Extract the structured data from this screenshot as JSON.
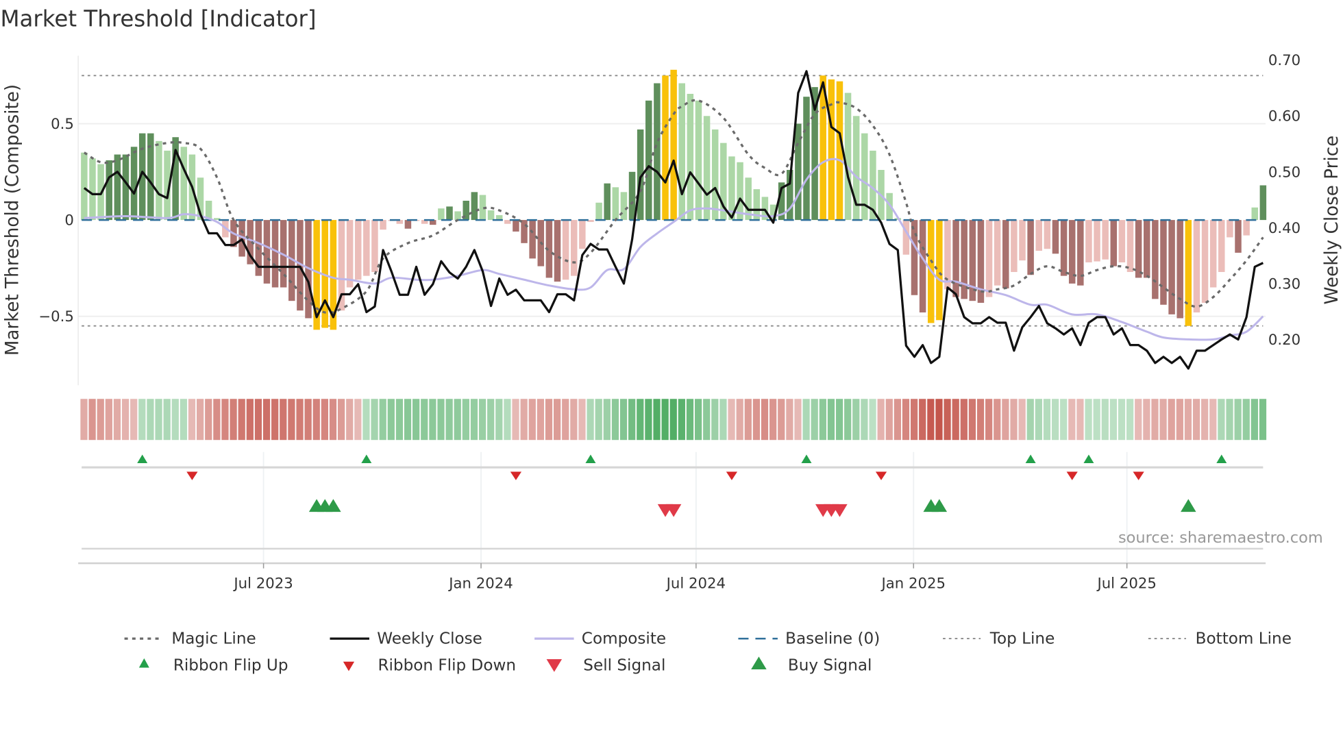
{
  "title": "Market Threshold [Indicator]",
  "source": "source: sharemaestro.com",
  "colors": {
    "dark_green": "#5f8f5c",
    "light_green": "#acd7a6",
    "dark_red": "#a8716e",
    "light_red": "#ebbdb9",
    "yellow": "#f9c10a",
    "close": "#111111",
    "composite": "#bdb6ea",
    "magic": "#6a6a6a",
    "baseline": "#2f6f9a",
    "guide": "#8a8a8a",
    "up": "#23a04a",
    "down": "#d62728",
    "sell": "#e03a48",
    "buy": "#2e9a48"
  },
  "chart_data": {
    "type": "bar+line",
    "title": "Market Threshold [Indicator]",
    "ylabel": "Market Threshold (Composite)",
    "y2label": "Weekly Close Price",
    "ylim": [
      -0.85,
      0.85
    ],
    "y2lim": [
      0.14,
      0.72
    ],
    "yticks": [
      {
        "v": 0.5,
        "label": "0.5"
      },
      {
        "v": 0,
        "label": "0"
      },
      {
        "v": -0.5,
        "label": "−0.5"
      }
    ],
    "y2ticks": [
      {
        "v": 0.7,
        "label": "0.70"
      },
      {
        "v": 0.6,
        "label": "0.60"
      },
      {
        "v": 0.5,
        "label": "0.50"
      },
      {
        "v": 0.4,
        "label": "0.40"
      },
      {
        "v": 0.3,
        "label": "0.30"
      },
      {
        "v": 0.2,
        "label": "0.20"
      }
    ],
    "xticks": [
      {
        "week": 21.6,
        "label": "Jul 2023"
      },
      {
        "week": 47.8,
        "label": "Jan 2024"
      },
      {
        "week": 73.7,
        "label": "Jul 2024"
      },
      {
        "week": 99.9,
        "label": "Jan 2025"
      },
      {
        "week": 125.6,
        "label": "Jul 2025"
      }
    ],
    "top_line": 0.75,
    "bottom_line": -0.55,
    "baseline": 0,
    "bars": {
      "values": [
        0.35,
        0.32,
        0.29,
        0.31,
        0.34,
        0.34,
        0.38,
        0.45,
        0.45,
        0.41,
        0.36,
        0.43,
        0.38,
        0.34,
        0.22,
        0.1,
        0.01,
        -0.09,
        -0.14,
        -0.19,
        -0.23,
        -0.29,
        -0.33,
        -0.35,
        -0.35,
        -0.42,
        -0.47,
        -0.51,
        -0.57,
        -0.56,
        -0.57,
        -0.47,
        -0.35,
        -0.31,
        -0.29,
        -0.27,
        -0.05,
        -0.005,
        -0.02,
        -0.045,
        -0.005,
        -0.02,
        -0.025,
        0.06,
        0.07,
        0.045,
        0.1,
        0.145,
        0.13,
        0.05,
        0.025,
        -0.02,
        -0.06,
        -0.12,
        -0.2,
        -0.24,
        -0.3,
        -0.32,
        -0.31,
        -0.29,
        -0.15,
        -0.01,
        0.09,
        0.19,
        0.17,
        0.145,
        0.25,
        0.47,
        0.62,
        0.71,
        0.75,
        0.78,
        0.71,
        0.655,
        0.62,
        0.54,
        0.47,
        0.4,
        0.33,
        0.3,
        0.22,
        0.16,
        0.12,
        0.08,
        0.195,
        0.26,
        0.5,
        0.64,
        0.69,
        0.75,
        0.73,
        0.72,
        0.66,
        0.54,
        0.45,
        0.36,
        0.26,
        0.14,
        0.01,
        -0.18,
        -0.39,
        -0.48,
        -0.535,
        -0.52,
        -0.36,
        -0.4,
        -0.41,
        -0.42,
        -0.43,
        -0.4,
        -0.34,
        -0.355,
        -0.27,
        -0.21,
        -0.285,
        -0.16,
        -0.15,
        -0.175,
        -0.29,
        -0.33,
        -0.34,
        -0.22,
        -0.215,
        -0.205,
        -0.24,
        -0.22,
        -0.27,
        -0.3,
        -0.3,
        -0.41,
        -0.44,
        -0.49,
        -0.51,
        -0.55,
        -0.48,
        -0.43,
        -0.35,
        -0.27,
        -0.09,
        -0.17,
        -0.08,
        0.065,
        0.18
      ],
      "class": [
        "lg",
        "lg",
        "lg",
        "dg",
        "dg",
        "dg",
        "dg",
        "dg",
        "dg",
        "lg",
        "lg",
        "dg",
        "lg",
        "lg",
        "lg",
        "lg",
        "lg",
        "lr",
        "dr",
        "dr",
        "dr",
        "dr",
        "dr",
        "dr",
        "dr",
        "dr",
        "dr",
        "dr",
        "y",
        "y",
        "y",
        "lr",
        "lr",
        "lr",
        "lr",
        "lr",
        "lr",
        "lr",
        "lr",
        "dr",
        "lr",
        "lr",
        "dr",
        "lg",
        "dg",
        "lg",
        "dg",
        "dg",
        "lg",
        "lg",
        "lg",
        "lr",
        "dr",
        "dr",
        "dr",
        "dr",
        "dr",
        "dr",
        "lr",
        "lr",
        "lr",
        "lr",
        "lg",
        "dg",
        "lg",
        "lg",
        "dg",
        "dg",
        "dg",
        "dg",
        "y",
        "y",
        "lg",
        "lg",
        "lg",
        "lg",
        "lg",
        "lg",
        "lg",
        "lg",
        "lg",
        "lg",
        "lg",
        "lg",
        "dg",
        "dg",
        "dg",
        "dg",
        "dg",
        "y",
        "y",
        "y",
        "lg",
        "lg",
        "lg",
        "lg",
        "lg",
        "lg",
        "lg",
        "lr",
        "dr",
        "dr",
        "y",
        "y",
        "lr",
        "dr",
        "dr",
        "dr",
        "dr",
        "lr",
        "lr",
        "dr",
        "lr",
        "lr",
        "dr",
        "lr",
        "lr",
        "dr",
        "dr",
        "dr",
        "dr",
        "lr",
        "lr",
        "lr",
        "dr",
        "lr",
        "lr",
        "dr",
        "dr",
        "dr",
        "dr",
        "dr",
        "dr",
        "y",
        "lr",
        "lr",
        "lr",
        "lr",
        "lr",
        "dr",
        "lr",
        "lg",
        "dg"
      ]
    },
    "weekly_close": [
      0.471,
      0.46,
      0.46,
      0.49,
      0.5,
      0.481,
      0.461,
      0.5,
      0.481,
      0.46,
      0.453,
      0.539,
      0.505,
      0.473,
      0.424,
      0.39,
      0.39,
      0.369,
      0.369,
      0.379,
      0.35,
      0.33,
      0.33,
      0.33,
      0.33,
      0.33,
      0.33,
      0.303,
      0.24,
      0.27,
      0.24,
      0.281,
      0.281,
      0.299,
      0.249,
      0.259,
      0.36,
      0.322,
      0.28,
      0.28,
      0.33,
      0.28,
      0.299,
      0.34,
      0.32,
      0.309,
      0.33,
      0.36,
      0.322,
      0.26,
      0.309,
      0.28,
      0.289,
      0.27,
      0.27,
      0.27,
      0.249,
      0.281,
      0.281,
      0.27,
      0.351,
      0.371,
      0.361,
      0.361,
      0.33,
      0.3,
      0.379,
      0.49,
      0.51,
      0.5,
      0.481,
      0.52,
      0.46,
      0.499,
      0.479,
      0.459,
      0.471,
      0.438,
      0.418,
      0.452,
      0.432,
      0.432,
      0.432,
      0.409,
      0.471,
      0.479,
      0.641,
      0.68,
      0.611,
      0.66,
      0.58,
      0.569,
      0.491,
      0.441,
      0.441,
      0.432,
      0.409,
      0.371,
      0.36,
      0.189,
      0.169,
      0.19,
      0.158,
      0.169,
      0.293,
      0.281,
      0.24,
      0.229,
      0.229,
      0.24,
      0.23,
      0.23,
      0.18,
      0.222,
      0.24,
      0.26,
      0.229,
      0.22,
      0.209,
      0.22,
      0.19,
      0.23,
      0.24,
      0.24,
      0.209,
      0.22,
      0.19,
      0.19,
      0.18,
      0.158,
      0.169,
      0.158,
      0.169,
      0.148,
      0.18,
      0.18,
      0.19,
      0.2,
      0.209,
      0.2,
      0.24,
      0.33,
      0.337
    ],
    "magic_line": [
      [
        0,
        0.35
      ],
      [
        2,
        0.3
      ],
      [
        4,
        0.31
      ],
      [
        7,
        0.37
      ],
      [
        10,
        0.4
      ],
      [
        12,
        0.4
      ],
      [
        14,
        0.37
      ],
      [
        16,
        0.22
      ],
      [
        18,
        0
      ],
      [
        21,
        -0.15
      ],
      [
        24,
        -0.28
      ],
      [
        27,
        -0.42
      ],
      [
        29,
        -0.48
      ],
      [
        31,
        -0.46
      ],
      [
        34,
        -0.37
      ],
      [
        36,
        -0.2
      ],
      [
        39,
        -0.12
      ],
      [
        42,
        -0.08
      ],
      [
        45,
        0
      ],
      [
        48,
        0.06
      ],
      [
        50,
        0.05
      ],
      [
        53,
        -0.02
      ],
      [
        56,
        -0.16
      ],
      [
        59,
        -0.22
      ],
      [
        61,
        -0.17
      ],
      [
        64,
        0
      ],
      [
        67,
        0.15
      ],
      [
        69,
        0.4
      ],
      [
        71,
        0.55
      ],
      [
        72,
        0.59
      ],
      [
        74,
        0.62
      ],
      [
        77,
        0.53
      ],
      [
        80,
        0.34
      ],
      [
        82,
        0.27
      ],
      [
        84,
        0.24
      ],
      [
        86,
        0.4
      ],
      [
        88,
        0.55
      ],
      [
        90,
        0.6
      ],
      [
        91,
        0.61
      ],
      [
        93,
        0.58
      ],
      [
        95,
        0.49
      ],
      [
        97,
        0.34
      ],
      [
        99,
        0.09
      ],
      [
        100,
        -0.06
      ],
      [
        102,
        -0.21
      ],
      [
        104,
        -0.31
      ],
      [
        108,
        -0.37
      ],
      [
        110,
        -0.36
      ],
      [
        112,
        -0.34
      ],
      [
        114,
        -0.28
      ],
      [
        116,
        -0.24
      ],
      [
        118,
        -0.27
      ],
      [
        120,
        -0.29
      ],
      [
        122,
        -0.26
      ],
      [
        124,
        -0.24
      ],
      [
        126,
        -0.25
      ],
      [
        128,
        -0.29
      ],
      [
        130,
        -0.35
      ],
      [
        132,
        -0.41
      ],
      [
        134,
        -0.45
      ],
      [
        136,
        -0.4
      ],
      [
        138,
        -0.31
      ],
      [
        140,
        -0.21
      ],
      [
        142,
        -0.09
      ]
    ],
    "composite": [
      [
        0,
        0.01
      ],
      [
        5,
        0.02
      ],
      [
        10,
        0.01
      ],
      [
        12,
        0.03
      ],
      [
        14,
        0.02
      ],
      [
        16,
        -0.01
      ],
      [
        18,
        -0.07
      ],
      [
        21,
        -0.12
      ],
      [
        24,
        -0.18
      ],
      [
        27,
        -0.25
      ],
      [
        30,
        -0.3
      ],
      [
        32,
        -0.31
      ],
      [
        35,
        -0.33
      ],
      [
        37,
        -0.3
      ],
      [
        40,
        -0.31
      ],
      [
        42,
        -0.31
      ],
      [
        45,
        -0.29
      ],
      [
        48,
        -0.26
      ],
      [
        50,
        -0.28
      ],
      [
        53,
        -0.31
      ],
      [
        56,
        -0.34
      ],
      [
        59,
        -0.36
      ],
      [
        61,
        -0.35
      ],
      [
        63,
        -0.26
      ],
      [
        65,
        -0.255
      ],
      [
        67,
        -0.14
      ],
      [
        69,
        -0.07
      ],
      [
        71,
        -0.01
      ],
      [
        73,
        0.05
      ],
      [
        75,
        0.06
      ],
      [
        77,
        0.05
      ],
      [
        80,
        0.03
      ],
      [
        83,
        0.02
      ],
      [
        85,
        0.06
      ],
      [
        87,
        0.21
      ],
      [
        89,
        0.3
      ],
      [
        91,
        0.31
      ],
      [
        93,
        0.225
      ],
      [
        95,
        0.165
      ],
      [
        97,
        0.08
      ],
      [
        99,
        -0.06
      ],
      [
        101,
        -0.2
      ],
      [
        103,
        -0.31
      ],
      [
        105,
        -0.32
      ],
      [
        108,
        -0.36
      ],
      [
        111,
        -0.39
      ],
      [
        114,
        -0.44
      ],
      [
        116,
        -0.44
      ],
      [
        119,
        -0.49
      ],
      [
        122,
        -0.49
      ],
      [
        125,
        -0.53
      ],
      [
        128,
        -0.58
      ],
      [
        130,
        -0.61
      ],
      [
        133,
        -0.62
      ],
      [
        136,
        -0.62
      ],
      [
        138,
        -0.6
      ],
      [
        140,
        -0.58
      ],
      [
        142,
        -0.5
      ]
    ],
    "ribbon": [
      -0.3,
      -0.45,
      -0.4,
      -0.35,
      -0.3,
      -0.25,
      -0.2,
      0.25,
      0.3,
      0.3,
      0.3,
      0.25,
      0.25,
      -0.2,
      -0.3,
      -0.4,
      -0.5,
      -0.55,
      -0.6,
      -0.65,
      -0.7,
      -0.7,
      -0.7,
      -0.68,
      -0.66,
      -0.64,
      -0.62,
      -0.6,
      -0.58,
      -0.55,
      -0.5,
      -0.4,
      -0.3,
      -0.2,
      0.25,
      0.35,
      0.45,
      0.5,
      0.5,
      0.52,
      0.52,
      0.5,
      0.5,
      0.5,
      0.48,
      0.48,
      0.45,
      0.45,
      0.42,
      0.4,
      0.35,
      0.25,
      -0.2,
      -0.3,
      -0.35,
      -0.35,
      -0.4,
      -0.4,
      -0.35,
      -0.3,
      -0.2,
      0.3,
      0.35,
      0.4,
      0.5,
      0.55,
      0.65,
      0.75,
      0.8,
      0.85,
      0.85,
      0.85,
      0.8,
      0.7,
      0.6,
      0.5,
      0.4,
      0.3,
      -0.2,
      -0.3,
      -0.4,
      -0.45,
      -0.5,
      -0.45,
      -0.4,
      -0.3,
      -0.2,
      0.3,
      0.4,
      0.5,
      0.55,
      0.55,
      0.5,
      0.4,
      0.3,
      0.2,
      -0.25,
      -0.35,
      -0.45,
      -0.55,
      -0.65,
      -0.75,
      -0.85,
      -0.9,
      -0.8,
      -0.75,
      -0.7,
      -0.65,
      -0.6,
      -0.55,
      -0.45,
      -0.35,
      -0.3,
      -0.2,
      0.35,
      0.3,
      0.25,
      0.22,
      0.2,
      -0.2,
      -0.2,
      0.2,
      0.2,
      0.22,
      0.2,
      0.2,
      0.2,
      -0.2,
      -0.25,
      -0.3,
      -0.3,
      -0.35,
      -0.35,
      -0.3,
      -0.3,
      -0.25,
      -0.2,
      0.3,
      0.35,
      0.4,
      0.45,
      0.55,
      0.6
    ],
    "ribbon_flip_up": [
      7,
      34,
      61,
      87,
      114,
      121,
      137
    ],
    "ribbon_flip_down": [
      13,
      52,
      78,
      96,
      119,
      127
    ],
    "buy_signal": [
      28,
      29,
      30,
      102,
      103,
      133
    ],
    "sell_signal": [
      70,
      71,
      89,
      90,
      91
    ],
    "legend": {
      "placement": "bottom",
      "items": [
        {
          "key": "magic",
          "label": "Magic Line"
        },
        {
          "key": "close",
          "label": "Weekly Close"
        },
        {
          "key": "composite",
          "label": "Composite"
        },
        {
          "key": "baseline",
          "label": "Baseline (0)"
        },
        {
          "key": "top",
          "label": "Top Line"
        },
        {
          "key": "bottom",
          "label": "Bottom Line"
        },
        {
          "key": "flipup",
          "label": "Ribbon Flip Up"
        },
        {
          "key": "flipdown",
          "label": "Ribbon Flip Down"
        },
        {
          "key": "sell",
          "label": "Sell Signal"
        },
        {
          "key": "buy",
          "label": "Buy Signal"
        }
      ]
    }
  }
}
